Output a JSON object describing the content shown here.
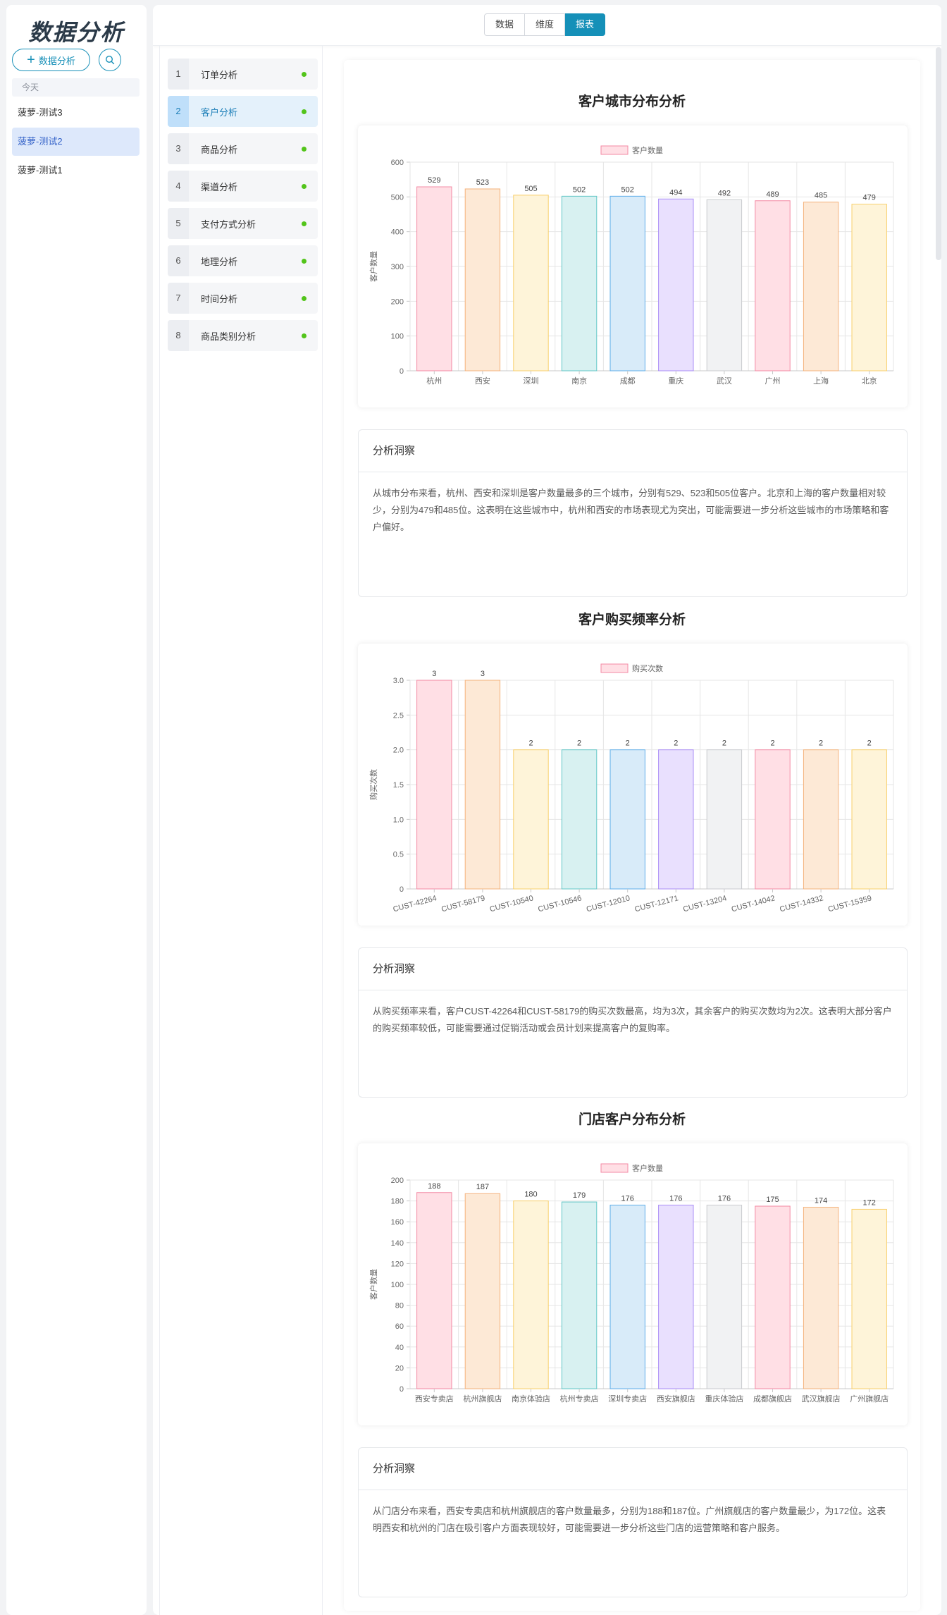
{
  "sidebar": {
    "app_title": "数据分析",
    "new_button": "数据分析",
    "date_group": "今天",
    "sessions": [
      "菠萝-测试3",
      "菠萝-测试2",
      "菠萝-测试1"
    ],
    "active_session": 1
  },
  "tabs": {
    "items": [
      "数据",
      "维度",
      "报表"
    ],
    "active": 2
  },
  "analyses": {
    "items": [
      {
        "num": "1",
        "label": "订单分析"
      },
      {
        "num": "2",
        "label": "客户分析"
      },
      {
        "num": "3",
        "label": "商品分析"
      },
      {
        "num": "4",
        "label": "渠道分析"
      },
      {
        "num": "5",
        "label": "支付方式分析"
      },
      {
        "num": "6",
        "label": "地理分析"
      },
      {
        "num": "7",
        "label": "时间分析"
      },
      {
        "num": "8",
        "label": "商品类别分析"
      }
    ],
    "active": 1,
    "status_color": "#52c41a"
  },
  "sections": [
    {
      "title": "客户城市分布分析",
      "insight_title": "分析洞察",
      "insight_text": "从城市分布来看，杭州、西安和深圳是客户数量最多的三个城市，分别有529、523和505位客户。北京和上海的客户数量相对较少，分别为479和485位。这表明在这些城市中，杭州和西安的市场表现尤为突出，可能需要进一步分析这些城市的市场策略和客户偏好。"
    },
    {
      "title": "客户购买频率分析",
      "insight_title": "分析洞察",
      "insight_text": "从购买频率来看，客户CUST-42264和CUST-58179的购买次数最高，均为3次，其余客户的购买次数均为2次。这表明大部分客户的购买频率较低，可能需要通过促销活动或会员计划来提高客户的复购率。"
    },
    {
      "title": "门店客户分布分析",
      "insight_title": "分析洞察",
      "insight_text": "从门店分布来看，西安专卖店和杭州旗舰店的客户数量最多，分别为188和187位。广州旗舰店的客户数量最少，为172位。这表明西安和杭州的门店在吸引客户方面表现较好，可能需要进一步分析这些门店的运营策略和客户服务。"
    }
  ],
  "chart_data": [
    {
      "type": "bar",
      "legend": "客户数量",
      "ylabel": "客户数量",
      "categories": [
        "杭州",
        "西安",
        "深圳",
        "南京",
        "成都",
        "重庆",
        "武汉",
        "广州",
        "上海",
        "北京"
      ],
      "values": [
        529,
        523,
        505,
        502,
        502,
        494,
        492,
        489,
        485,
        479
      ],
      "yticks": [
        "0",
        "100",
        "200",
        "300",
        "400",
        "500",
        "600"
      ],
      "ylim": [
        0,
        600
      ],
      "rotate_labels": false,
      "grid": true,
      "legend_position": "top"
    },
    {
      "type": "bar",
      "legend": "购买次数",
      "ylabel": "购买次数",
      "categories": [
        "CUST-42264",
        "CUST-58179",
        "CUST-10540",
        "CUST-10546",
        "CUST-12010",
        "CUST-12171",
        "CUST-13204",
        "CUST-14042",
        "CUST-14332",
        "CUST-15359"
      ],
      "values": [
        3,
        3,
        2,
        2,
        2,
        2,
        2,
        2,
        2,
        2
      ],
      "yticks": [
        "0",
        "0.5",
        "1.0",
        "1.5",
        "2.0",
        "2.5",
        "3.0"
      ],
      "ylim": [
        0,
        3
      ],
      "rotate_labels": true,
      "grid": true,
      "legend_position": "top"
    },
    {
      "type": "bar",
      "legend": "客户数量",
      "ylabel": "客户数量",
      "categories": [
        "西安专卖店",
        "杭州旗舰店",
        "南京体验店",
        "杭州专卖店",
        "深圳专卖店",
        "西安旗舰店",
        "重庆体验店",
        "成都旗舰店",
        "武汉旗舰店",
        "广州旗舰店"
      ],
      "values": [
        188,
        187,
        180,
        179,
        176,
        176,
        176,
        175,
        174,
        172
      ],
      "yticks": [
        "0",
        "20",
        "40",
        "60",
        "80",
        "100",
        "120",
        "140",
        "160",
        "180",
        "200"
      ],
      "ylim": [
        0,
        200
      ],
      "rotate_labels": false,
      "grid": true,
      "legend_position": "top"
    }
  ],
  "palette": {
    "fills": [
      "#ffdfe5",
      "#fde9d6",
      "#fef4d9",
      "#d8f1f1",
      "#d8ebf9",
      "#e9e0fe",
      "#f1f2f3"
    ],
    "strokes": [
      "#f38aa4",
      "#f4b27c",
      "#f8cf6b",
      "#61c6c6",
      "#5eaee9",
      "#a98df6",
      "#c9cbcf"
    ],
    "accent": "#1590b8"
  }
}
